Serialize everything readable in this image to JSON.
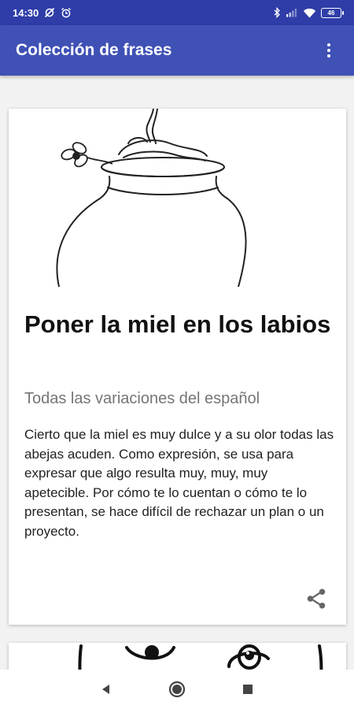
{
  "status_bar": {
    "time": "14:30",
    "battery": "46",
    "icons": [
      "sync-off-icon",
      "alarm-icon",
      "bluetooth-icon",
      "signal-icon",
      "wifi-icon",
      "battery-icon"
    ]
  },
  "app_bar": {
    "title": "Colección de frases",
    "overflow_icon": "more-vert-icon"
  },
  "cards": [
    {
      "image": "honey-pot-illustration",
      "title": "Poner la miel en los labios",
      "subtitle": "Todas las variaciones del español",
      "body": "Cierto que la miel es muy dulce y a su olor todas las abejas acuden. Como expresión, se usa para expresar que algo resulta muy, muy, muy apetecible. Por cómo te lo cuentan o cómo te lo presentan, se hace difícil de rechazar un plan o un proyecto.",
      "share_icon": "share-icon"
    },
    {
      "image": "eyes-illustration"
    }
  ],
  "nav_bar": {
    "icons": [
      "back-icon",
      "home-icon",
      "recents-icon"
    ]
  },
  "colors": {
    "status_bar": "#2f3da8",
    "app_bar": "#3f51b5",
    "background": "#f2f2f2",
    "card": "#ffffff",
    "subtitle": "#757575"
  }
}
